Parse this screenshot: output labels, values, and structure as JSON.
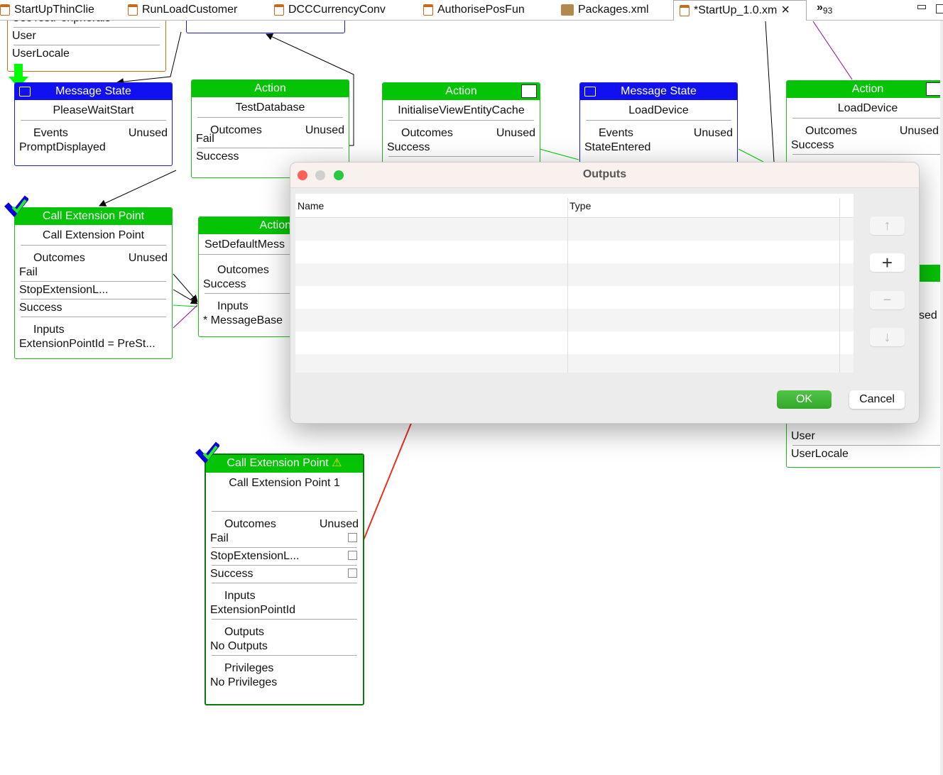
{
  "tabs": [
    {
      "label": "StartUpThinClie"
    },
    {
      "label": "RunLoadCustomer"
    },
    {
      "label": "DCCCurrencyConv"
    },
    {
      "label": "AuthorisePosFun"
    },
    {
      "label": "Packages.xml"
    },
    {
      "label": "*StartUp_1.0.xm",
      "active": true,
      "close": "×"
    }
  ],
  "overflow": {
    "chevron": "»",
    "count": "93"
  },
  "nodes": {
    "top_left": {
      "items": [
        "UseTestPeripherals",
        "User",
        "UserLocale"
      ]
    },
    "msg1": {
      "header": "Message State",
      "name": "PleaseWaitStart",
      "events": "Events",
      "unused": "Unused",
      "items": [
        "PromptDisplayed"
      ]
    },
    "act1": {
      "header": "Action",
      "name": "TestDatabase",
      "outcomes": "Outcomes",
      "unused": "Unused",
      "items": [
        "Fail",
        "Success"
      ]
    },
    "act2": {
      "header": "Action",
      "name": "InitialiseViewEntityCache",
      "outcomes": "Outcomes",
      "unused": "Unused",
      "items": [
        "Success"
      ]
    },
    "msg2": {
      "header": "Message State",
      "name": "LoadDevice",
      "events": "Events",
      "unused": "Unused",
      "items": [
        "StateEntered"
      ]
    },
    "act3": {
      "header": "Action",
      "name": "LoadDevice",
      "outcomes": "Outcomes",
      "unused": "Unused",
      "items": [
        "Success"
      ],
      "partial": "sed",
      "bottom_items": [
        "User",
        "UserLocale"
      ]
    },
    "cep1": {
      "header": "Call Extension Point",
      "name": "Call Extension Point",
      "outcomes": "Outcomes",
      "unused": "Unused",
      "items": [
        "Fail",
        "StopExtensionL...",
        "Success"
      ],
      "inputs": "Inputs",
      "input_items": [
        "ExtensionPointId = PreSt..."
      ]
    },
    "act4": {
      "header": "Action",
      "name": "SetDefaultMess",
      "outcomes": "Outcomes",
      "items": [
        "Success"
      ],
      "inputs": "Inputs",
      "input_items": [
        "* MessageBase"
      ]
    },
    "cep2": {
      "header": "Call Extension Point",
      "name": "Call Extension Point 1",
      "outcomes": "Outcomes",
      "unused": "Unused",
      "items": [
        "Fail",
        "StopExtensionL...",
        "Success"
      ],
      "inputs": "Inputs",
      "input_items": [
        "ExtensionPointId"
      ],
      "outputs": "Outputs",
      "outputs_value": "No Outputs",
      "privileges": "Privileges",
      "privileges_value": "No Privileges",
      "warning": "⚠"
    }
  },
  "dialog": {
    "title": "Outputs",
    "columns": [
      "Name",
      "Type"
    ],
    "rows": [],
    "buttons": {
      "up": "↑",
      "add": "+",
      "remove": "−",
      "down": "↓",
      "ok": "OK",
      "cancel": "Cancel"
    }
  },
  "colors": {
    "action": "#05c305",
    "state": "#1010f0",
    "ok": "#3cb432",
    "annotation": "#e8321e"
  }
}
